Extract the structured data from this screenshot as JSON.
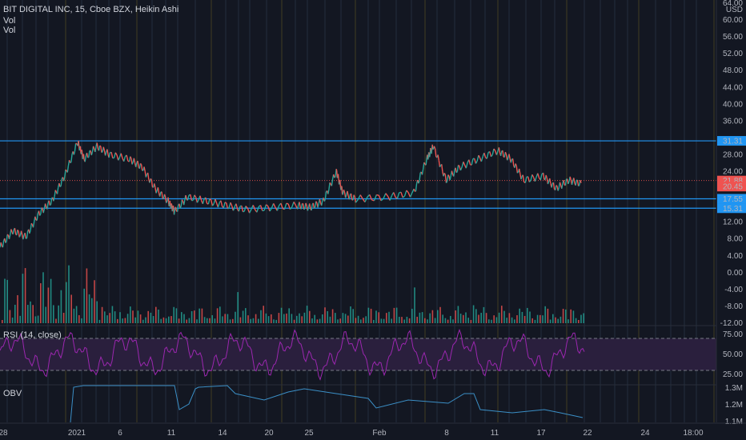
{
  "header": {
    "symbol_line": "BIT DIGITAL INC, 15, Cboe BZX, Heikin Ashi",
    "vol1": "Vol",
    "vol2": "Vol"
  },
  "rsi": {
    "label": "RSI (14, close)",
    "upper": 70,
    "lower": 30
  },
  "obv": {
    "label": "OBV"
  },
  "colors": {
    "up": "#26a69a",
    "down": "#ef5350",
    "line_level": "#2196f3",
    "rsi_line": "#9c27b0",
    "rsi_band": "#2a1f3d",
    "obv_line": "#3b8fc6",
    "current_price_line": "#ef5350"
  },
  "price_axis": {
    "currency": "USD",
    "ticks": [
      "64.00",
      "60.00",
      "56.00",
      "52.00",
      "48.00",
      "44.00",
      "40.00",
      "36.00",
      "28.00",
      "24.00",
      "12.00",
      "8.00",
      "4.00",
      "0.00",
      "-4.00",
      "-8.00",
      "-12.00"
    ],
    "badges": [
      {
        "label": "31.31",
        "color": "#2196f3"
      },
      {
        "label": "21.88",
        "color": "#ef5350"
      },
      {
        "label": "20.45",
        "color": "#ef5350"
      },
      {
        "label": "17.55",
        "color": "#2196f3"
      },
      {
        "label": "15.31",
        "color": "#2196f3"
      }
    ]
  },
  "rsi_axis": {
    "ticks": [
      "75.00",
      "50.00",
      "25.00"
    ]
  },
  "obv_axis": {
    "ticks": [
      "1.3M",
      "1.2M",
      "1.1M"
    ]
  },
  "time_axis": {
    "ticks": [
      "28",
      "2021",
      "6",
      "11",
      "14",
      "20",
      "25",
      "Feb",
      "8",
      "11",
      "17",
      "22",
      "24",
      "18:00"
    ]
  },
  "chart_data": {
    "type": "line",
    "title": "BIT DIGITAL INC, 15, Cboe BZX, Heikin Ashi",
    "price_levels": [
      31.31,
      17.55,
      15.31
    ],
    "current_price": 21.88,
    "price_path": [
      [
        0,
        6
      ],
      [
        0.02,
        10
      ],
      [
        0.04,
        8.5
      ],
      [
        0.06,
        14
      ],
      [
        0.08,
        17
      ],
      [
        0.1,
        23
      ],
      [
        0.12,
        31
      ],
      [
        0.13,
        27
      ],
      [
        0.15,
        30
      ],
      [
        0.17,
        28
      ],
      [
        0.2,
        27
      ],
      [
        0.22,
        25
      ],
      [
        0.24,
        20
      ],
      [
        0.26,
        17
      ],
      [
        0.27,
        14.5
      ],
      [
        0.29,
        18
      ],
      [
        0.32,
        17
      ],
      [
        0.35,
        16
      ],
      [
        0.38,
        15
      ],
      [
        0.42,
        15.5
      ],
      [
        0.46,
        16
      ],
      [
        0.48,
        15.5
      ],
      [
        0.5,
        17
      ],
      [
        0.52,
        24
      ],
      [
        0.53,
        19
      ],
      [
        0.55,
        17.5
      ],
      [
        0.6,
        18
      ],
      [
        0.64,
        19
      ],
      [
        0.66,
        27
      ],
      [
        0.67,
        30
      ],
      [
        0.69,
        22
      ],
      [
        0.71,
        25
      ],
      [
        0.74,
        27
      ],
      [
        0.77,
        29
      ],
      [
        0.79,
        27
      ],
      [
        0.81,
        22
      ],
      [
        0.84,
        23
      ],
      [
        0.86,
        20
      ],
      [
        0.88,
        22
      ],
      [
        0.9,
        21
      ]
    ]
  }
}
